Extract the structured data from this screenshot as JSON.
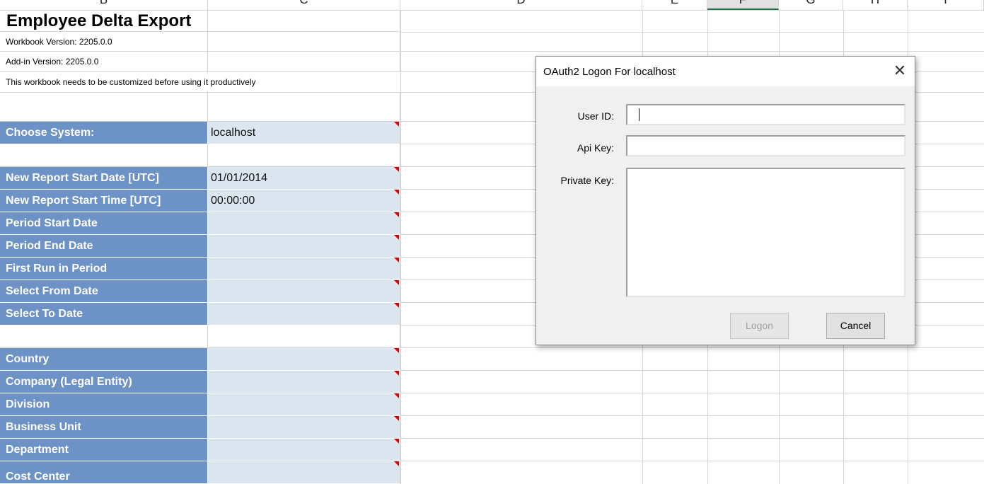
{
  "columns": [
    "B",
    "C",
    "D",
    "E",
    "F",
    "G",
    "H",
    "I"
  ],
  "selected_column": "F",
  "sheet": {
    "title": "Employee Delta Export",
    "info_rows": [
      "Workbook Version: 2205.0.0",
      "Add-in Version: 2205.0.0",
      "This workbook needs to be customized before using it productively"
    ],
    "fields": [
      {
        "label": "Choose System:",
        "value": "localhost"
      },
      {
        "label": "New Report Start Date [UTC]",
        "value": "01/01/2014"
      },
      {
        "label": "New Report Start Time [UTC]",
        "value": "00:00:00"
      },
      {
        "label": "Period Start Date",
        "value": ""
      },
      {
        "label": "Period End Date",
        "value": ""
      },
      {
        "label": "First Run in Period",
        "value": ""
      },
      {
        "label": "Select From Date",
        "value": ""
      },
      {
        "label": "Select To Date",
        "value": ""
      },
      {
        "label": "Country",
        "value": ""
      },
      {
        "label": "Company (Legal Entity)",
        "value": ""
      },
      {
        "label": "Division",
        "value": ""
      },
      {
        "label": "Business Unit",
        "value": ""
      },
      {
        "label": "Department",
        "value": ""
      },
      {
        "label": "Cost Center",
        "value": ""
      }
    ]
  },
  "dialog": {
    "title": "OAuth2 Logon For localhost",
    "close_icon": "close-icon",
    "user_id_label": "User ID:",
    "user_id_value": "",
    "api_key_label": "Api Key:",
    "api_key_value": "",
    "private_key_label": "Private Key:",
    "private_key_value": "",
    "logon_label": "Logon",
    "logon_enabled": false,
    "cancel_label": "Cancel"
  },
  "colors": {
    "field_label_bg": "#6d93c6",
    "field_value_bg": "#dce6f1",
    "comment_marker": "#e00000",
    "selected_column_accent": "#217346"
  }
}
